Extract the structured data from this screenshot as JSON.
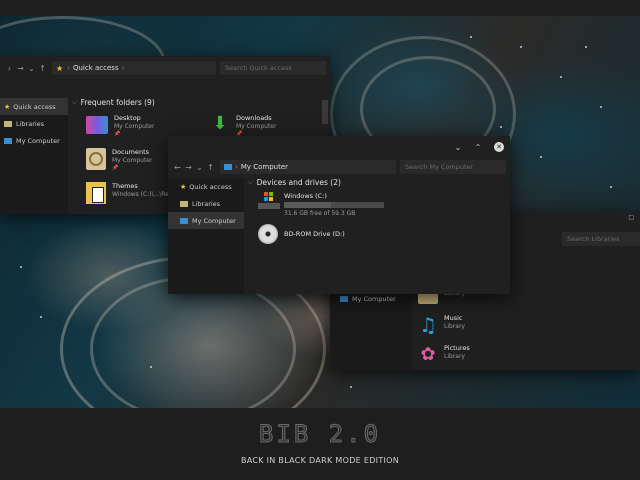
{
  "brand": {
    "title": "BIB 2.0",
    "subtitle": "BACK IN BLACK DARK MODE EDITION"
  },
  "win1": {
    "path": "Quick access",
    "search_placeholder": "Search Quick access",
    "sidebar": [
      "Quick access",
      "Libraries",
      "My Computer"
    ],
    "section_title": "Frequent folders (9)",
    "folders": [
      {
        "name": "Desktop",
        "location": "My Computer"
      },
      {
        "name": "Downloads",
        "location": "My Computer"
      },
      {
        "name": "Documents",
        "location": "My Computer"
      },
      {
        "name": "Themes",
        "location": "Windows (C:)\\...\\Re"
      }
    ]
  },
  "win2": {
    "path": "My Computer",
    "search_placeholder": "Search My Computer",
    "sidebar": [
      "Quick access",
      "Libraries",
      "My Computer"
    ],
    "section_title": "Devices and drives (2)",
    "drives": [
      {
        "name": "Windows (C:)",
        "detail": "31.6 GB free of 59.3 GB",
        "used_fraction": 0.47
      },
      {
        "name": "BD-ROM Drive (D:)"
      }
    ]
  },
  "win3": {
    "search_placeholder": "Search Libraries",
    "sidebar": [
      "My Computer"
    ],
    "libraries": [
      {
        "name": "",
        "type": "Library"
      },
      {
        "name": "Music",
        "type": "Library"
      },
      {
        "name": "Pictures",
        "type": "Library"
      }
    ]
  },
  "colors": {
    "window_bg": "#202020",
    "sidebar_bg": "#1a1a1a",
    "selected": "#333333",
    "accent_blue": "#3a8fd1",
    "download_green": "#3fb93f"
  }
}
